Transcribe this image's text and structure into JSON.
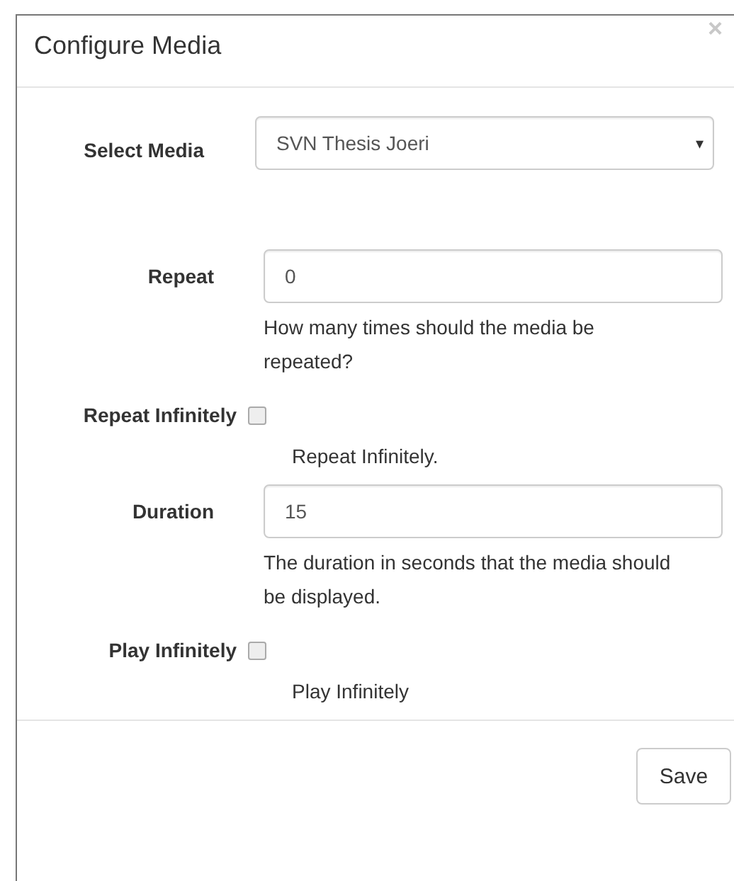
{
  "dialog": {
    "title": "Configure Media",
    "close": "×"
  },
  "fields": [
    {
      "kind": "select",
      "label": "Select Media",
      "value": "SVN Thesis Joeri",
      "caret": "▾"
    },
    {
      "kind": "text",
      "label": "Repeat",
      "value": "0",
      "help": "How many times should the media be repeated?"
    },
    {
      "kind": "checkbox",
      "label": "Repeat Infinitely",
      "checked": false,
      "help": "Repeat Infinitely."
    },
    {
      "kind": "text",
      "label": "Duration",
      "value": "15",
      "help": "The duration in seconds that the media should be displayed."
    },
    {
      "kind": "checkbox",
      "label": "Play Infinitely",
      "checked": false,
      "help": "Play Infinitely"
    }
  ],
  "buttons": [
    "Save"
  ]
}
